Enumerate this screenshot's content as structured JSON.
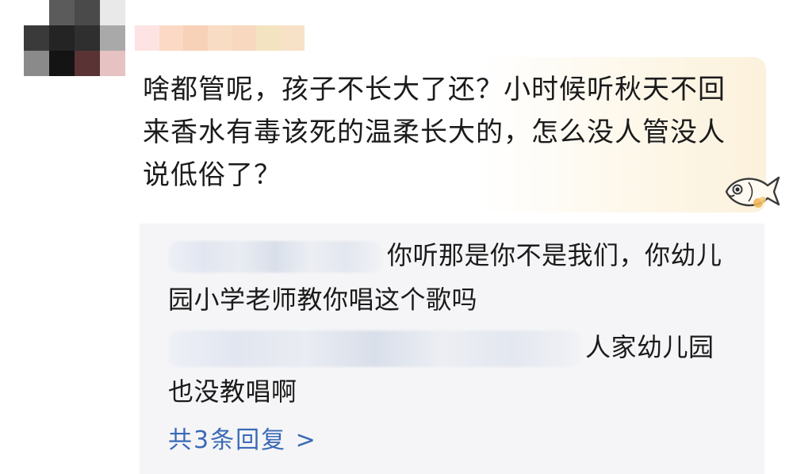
{
  "comment": {
    "author_avatar_icon": "pixelated-avatar",
    "username": "",
    "text": "啥都管呢，孩子不长大了还？小时候听秋天不回来香水有毒该死的温柔长大的，怎么没人管没人说低俗了？",
    "sticker_icon": "fish-sticker-icon"
  },
  "replies": [
    {
      "author": "",
      "text": "你听那是你不是我们，你幼儿园小学老师教你唱这个歌吗"
    },
    {
      "author": "",
      "text": "人家幼儿园也没教唱啊"
    }
  ],
  "more_replies_label": "共3条回复 >",
  "colors": {
    "link": "#3a6ab6",
    "reply_bg": "#f5f5f7",
    "bubble_tint": "#fbf1dc"
  }
}
